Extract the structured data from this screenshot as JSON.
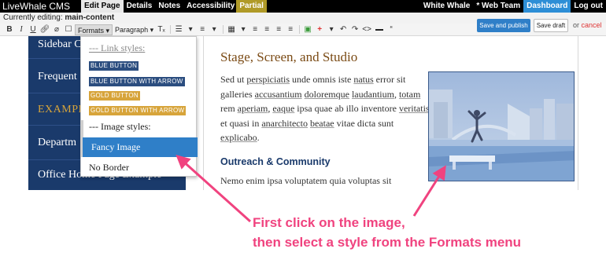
{
  "topbar": {
    "brand": "LiveWhale CMS",
    "tabs": [
      "Edit Page",
      "Details",
      "Notes",
      "Accessibility"
    ],
    "partial_label": "Partial",
    "right": {
      "group": "White Whale",
      "team": "* Web Team",
      "dashboard": "Dashboard",
      "logout": "Log out"
    }
  },
  "subbar": {
    "prefix": "Currently editing:",
    "value": "main-content"
  },
  "toolbar": {
    "formats_label": "Formats",
    "paragraph_label": "Paragraph",
    "save_publish": "Save and publish",
    "save_draft": "Save draft",
    "or_text": "or",
    "cancel": "cancel"
  },
  "sidebar": {
    "items": [
      "Sidebar C",
      "Frequent",
      "EXAMPLE",
      "Departm",
      "Office Home Page Example"
    ]
  },
  "content": {
    "heading": "Stage, Screen, and Studio",
    "paragraph1_parts": [
      {
        "t": "Sed ut ",
        "u": false
      },
      {
        "t": "perspiciatis",
        "u": true
      },
      {
        "t": " unde omnis iste ",
        "u": false
      },
      {
        "t": "natus",
        "u": true
      },
      {
        "t": " error sit galleries ",
        "u": false
      },
      {
        "t": "accusantium",
        "u": true
      },
      {
        "t": " ",
        "u": false
      },
      {
        "t": "doloremque",
        "u": true
      },
      {
        "t": " ",
        "u": false
      },
      {
        "t": "laudantium",
        "u": true
      },
      {
        "t": ", ",
        "u": false
      },
      {
        "t": "totam",
        "u": true
      },
      {
        "t": " rem ",
        "u": false
      },
      {
        "t": "aperiam",
        "u": true
      },
      {
        "t": ", ",
        "u": false
      },
      {
        "t": "eaque",
        "u": true
      },
      {
        "t": " ipsa quae ab illo inventore ",
        "u": false
      },
      {
        "t": "veritatis",
        "u": true
      },
      {
        "t": " et quasi in ",
        "u": false
      },
      {
        "t": "anarchitecto",
        "u": true
      },
      {
        "t": " ",
        "u": false
      },
      {
        "t": "beatae",
        "u": true
      },
      {
        "t": " vitae dicta sunt ",
        "u": false
      },
      {
        "t": "explicabo",
        "u": true
      },
      {
        "t": ".",
        "u": false
      }
    ],
    "subheading": "Outreach & Community",
    "paragraph2": "Nemo enim ipsa voluptatem quia voluptas sit"
  },
  "formats_menu": {
    "link_styles": "--- Link styles:",
    "blue_button": "Blue Button",
    "blue_button_arrow": "Blue Button with Arrow",
    "gold_button": "Gold Button",
    "gold_button_arrow": "Gold Button with Arrow",
    "image_styles": "--- Image styles:",
    "fancy_image": "Fancy Image",
    "no_border": "No Border"
  },
  "callout": {
    "line1": "First click on the image,",
    "line2": "then select a style from the Formats menu"
  },
  "colors": {
    "accent": "#f0437f",
    "navy": "#1a3a6b",
    "gold": "#d7a43a",
    "blue": "#2f7fc8"
  }
}
